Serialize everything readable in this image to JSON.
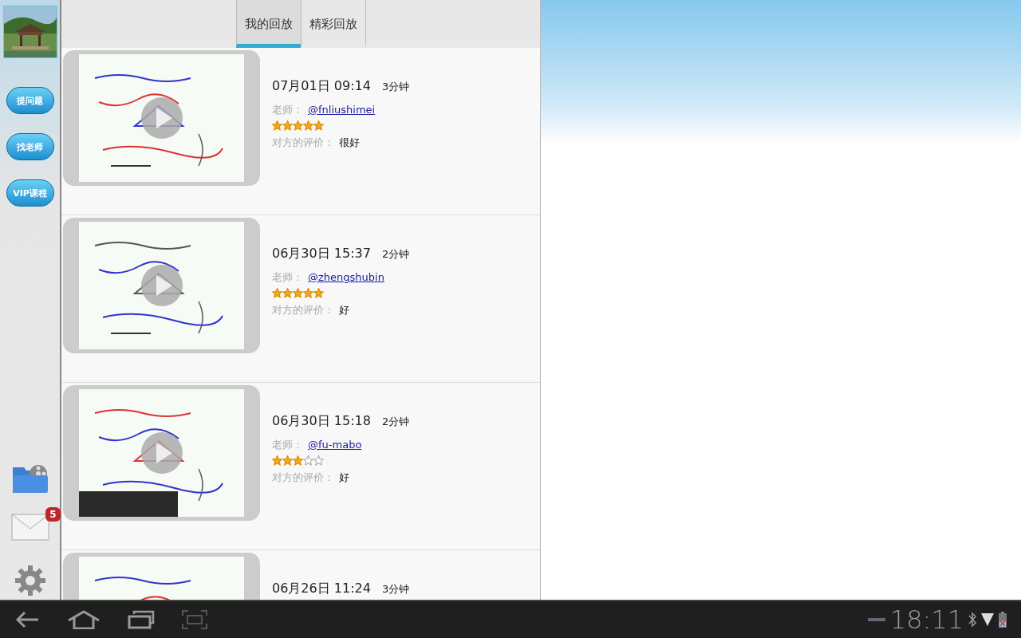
{
  "sidebar": {
    "buttons": [
      "提问题",
      "找老师",
      "VIP课程"
    ],
    "mail_badge": "5"
  },
  "tabs": [
    {
      "label": "我的回放",
      "selected": true
    },
    {
      "label": "精彩回放",
      "selected": false
    }
  ],
  "recordings": [
    {
      "date": "07月01日 09:14",
      "duration": "3分钟",
      "teacher_label": "老师：",
      "teacher": "@fnliushimei",
      "stars": 5,
      "comment_label": "对方的评价：",
      "comment": "很好"
    },
    {
      "date": "06月30日 15:37",
      "duration": "2分钟",
      "teacher_label": "老师：",
      "teacher": "@zhengshubin",
      "stars": 5,
      "comment_label": "对方的评价：",
      "comment": "好"
    },
    {
      "date": "06月30日 15:18",
      "duration": "2分钟",
      "teacher_label": "老师：",
      "teacher": "@fu-mabo",
      "stars": 3,
      "comment_label": "对方的评价：",
      "comment": "好"
    },
    {
      "date": "06月26日 11:24",
      "duration": "3分钟"
    }
  ],
  "status_bar": {
    "time": "18:11"
  }
}
